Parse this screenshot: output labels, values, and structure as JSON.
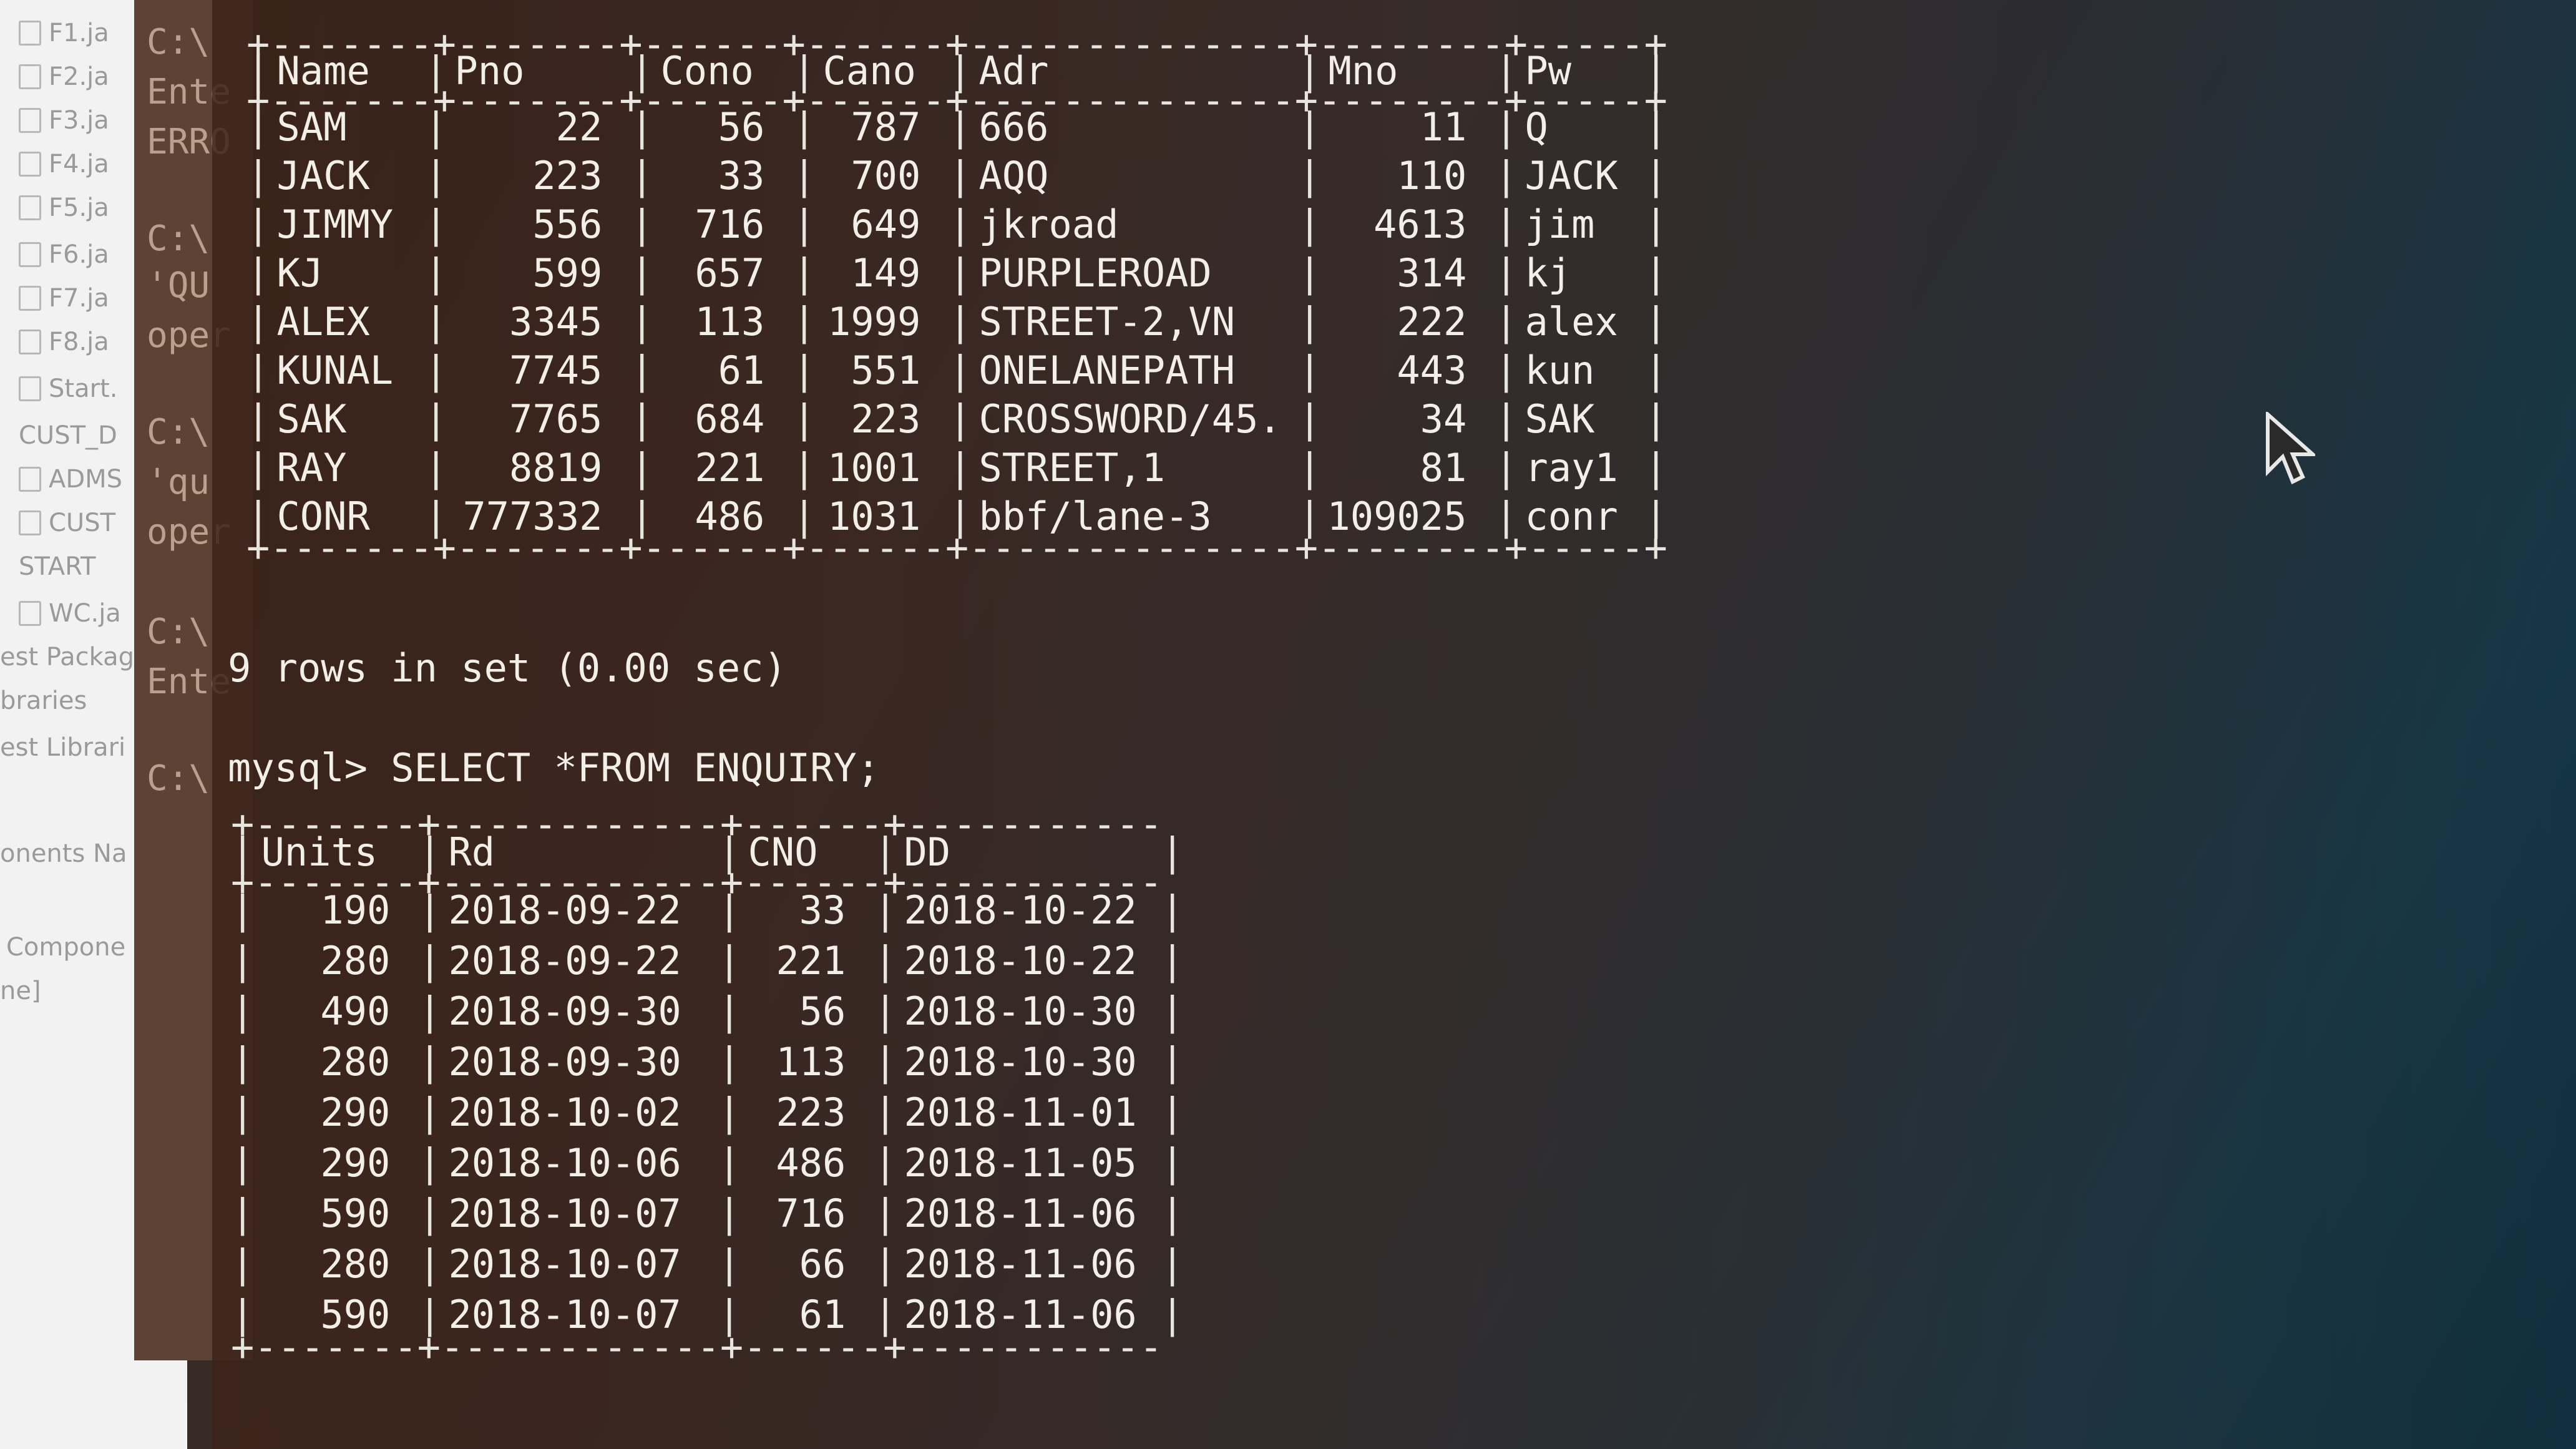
{
  "ide_sidebar": {
    "items": [
      "F1.ja",
      "F2.ja",
      "F3.ja",
      "F4.ja",
      "F5.ja",
      "F6.ja",
      "F7.ja",
      "F8.ja",
      "Start.",
      "CUST_D",
      "ADMS",
      "CUST",
      "START",
      "WC.ja",
      "est Packag",
      "braries",
      "est Librari",
      "onents Na",
      "Compone",
      "ne]"
    ]
  },
  "back_console": {
    "lines": [
      "C:\\",
      "Ente",
      "ERRO",
      "C:\\",
      "'QU",
      "oper",
      "C:\\",
      "'qu",
      "oper",
      "C:\\",
      "Ente",
      "C:\\"
    ]
  },
  "customer_table": {
    "headers": [
      "Name",
      "Pno",
      "Cono",
      "Cano",
      "Adr",
      "Mno",
      "Pw"
    ],
    "rows": [
      [
        "SAM",
        "22",
        "56",
        "787",
        "666",
        "11",
        "Q"
      ],
      [
        "JACK",
        "223",
        "33",
        "700",
        "AQQ",
        "110",
        "JACK"
      ],
      [
        "JIMMY",
        "556",
        "716",
        "649",
        "jkroad",
        "4613",
        "jim"
      ],
      [
        "KJ",
        "599",
        "657",
        "149",
        "PURPLEROAD",
        "314",
        "kj"
      ],
      [
        "ALEX",
        "3345",
        "113",
        "1999",
        "STREET-2,VN",
        "222",
        "alex"
      ],
      [
        "KUNAL",
        "7745",
        "61",
        "551",
        "ONELANEPATH",
        "443",
        "kun"
      ],
      [
        "SAK",
        "7765",
        "684",
        "223",
        "CROSSWORD/45.",
        "34",
        "SAK"
      ],
      [
        "RAY",
        "8819",
        "221",
        "1001",
        "STREET,1",
        "81",
        "ray1"
      ],
      [
        "CONR",
        "777332",
        "486",
        "1031",
        "bbf/lane-3",
        "109025",
        "conr"
      ]
    ]
  },
  "result_status": "9 rows in set (0.00 sec)",
  "query_line": "mysql> SELECT *FROM ENQUIRY;",
  "enquiry_table": {
    "headers": [
      "Units",
      "Rd",
      "CNO",
      "DD"
    ],
    "rows": [
      [
        "190",
        "2018-09-22",
        "33",
        "2018-10-22"
      ],
      [
        "280",
        "2018-09-22",
        "221",
        "2018-10-22"
      ],
      [
        "490",
        "2018-09-30",
        "56",
        "2018-10-30"
      ],
      [
        "280",
        "2018-09-30",
        "113",
        "2018-10-30"
      ],
      [
        "290",
        "2018-10-02",
        "223",
        "2018-11-01"
      ],
      [
        "290",
        "2018-10-06",
        "486",
        "2018-11-05"
      ],
      [
        "590",
        "2018-10-07",
        "716",
        "2018-11-06"
      ],
      [
        "280",
        "2018-10-07",
        "66",
        "2018-11-06"
      ],
      [
        "590",
        "2018-10-07",
        "61",
        "2018-11-06"
      ]
    ]
  },
  "cursor": "mouse-pointer-icon"
}
